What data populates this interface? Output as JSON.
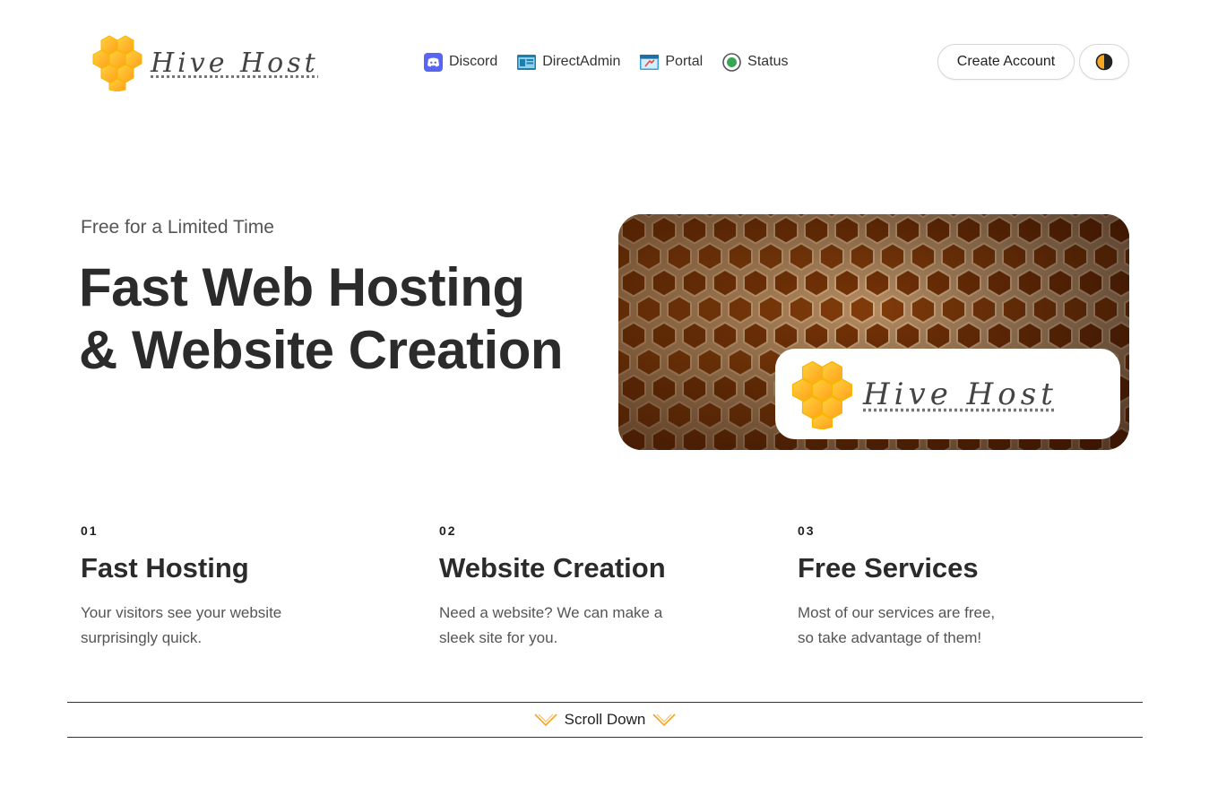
{
  "header": {
    "logo_text": "Hive Host",
    "nav": [
      {
        "label": "Discord",
        "icon": "discord-icon"
      },
      {
        "label": "DirectAdmin",
        "icon": "directadmin-icon"
      },
      {
        "label": "Portal",
        "icon": "portal-icon"
      },
      {
        "label": "Status",
        "icon": "status-icon"
      }
    ],
    "create_account_label": "Create Account",
    "theme_toggle_icon": "half-moon-icon"
  },
  "hero": {
    "eyebrow": "Free for a Limited Time",
    "title_line1": "Fast Web Hosting",
    "title_line2": "& Website Creation",
    "badge_text": "Hive Host"
  },
  "features": [
    {
      "number": "01",
      "title": "Fast Hosting",
      "desc_line1": "Your visitors see your website",
      "desc_line2": "surprisingly quick."
    },
    {
      "number": "02",
      "title": "Website Creation",
      "desc_line1": "Need a website? We can make a",
      "desc_line2": "sleek site for you."
    },
    {
      "number": "03",
      "title": "Free Services",
      "desc_line1": "Most of our services are free,",
      "desc_line2": "so take advantage of them!"
    }
  ],
  "scroll": {
    "label": "Scroll Down"
  },
  "colors": {
    "accent": "#f5a623",
    "honey": "#ffb300",
    "discord": "#5865f2",
    "status": "#3aa655"
  }
}
